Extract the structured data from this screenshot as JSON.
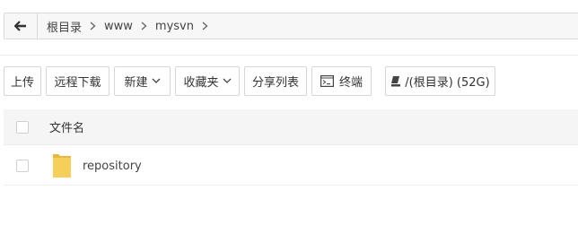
{
  "breadcrumb": {
    "items": [
      "根目录",
      "www",
      "mysvn"
    ]
  },
  "toolbar": {
    "upload": "上传",
    "remote_download": "远程下载",
    "new": "新建",
    "favorites": "收藏夹",
    "share_list": "分享列表",
    "terminal": "终端",
    "disk": "/(根目录) (52G)"
  },
  "list": {
    "header_name": "文件名",
    "rows": [
      {
        "name": "repository",
        "type": "folder"
      }
    ]
  },
  "colors": {
    "folder": "#f3c94a",
    "border": "#d6d6d6",
    "header_bg": "#f5f5f5"
  }
}
